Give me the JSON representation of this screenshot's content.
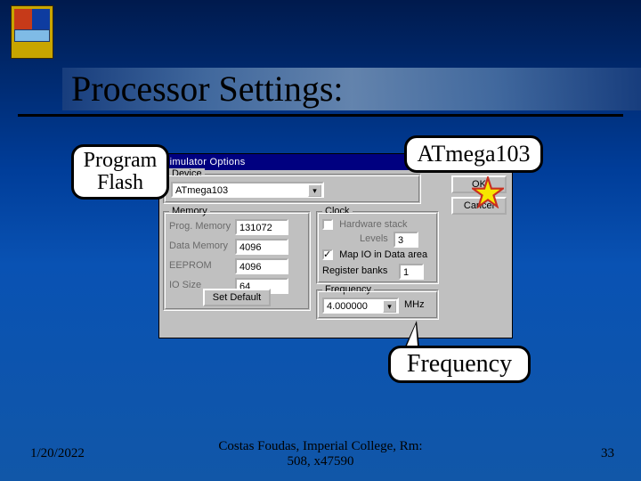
{
  "slide": {
    "title": "Processor Settings:",
    "date": "1/20/2022",
    "footer_center_line1": "Costas Foudas, Imperial College, Rm:",
    "footer_center_line2": "508, x47590",
    "page_num": "33"
  },
  "callouts": {
    "program_flash_line1": "Program",
    "program_flash_line2": "Flash",
    "atmega": "ATmega103",
    "frequency": "Frequency"
  },
  "dialog": {
    "title": "Simulator Options",
    "device_group": "Device",
    "device_value": "ATmega103",
    "memory_group": "Memory",
    "prog_mem_label": "Prog. Memory",
    "prog_mem_value": "131072",
    "data_mem_label": "Data Memory",
    "data_mem_value": "4096",
    "eeprom_label": "EEPROM",
    "eeprom_value": "4096",
    "io_size_label": "IO Size",
    "io_size_value": "64",
    "set_default_btn": "Set Default",
    "clock_group": "Clock",
    "hw_stack_label": "Hardware stack",
    "levels_label": "Levels",
    "levels_value": "3",
    "map_io_label": "Map IO in Data area",
    "reg_banks_label": "Register banks",
    "reg_banks_value": "1",
    "freq_group": "Frequency",
    "freq_value": "4.000000",
    "freq_unit": "MHz",
    "ok_btn": "OK",
    "cancel_btn": "Cancel"
  }
}
